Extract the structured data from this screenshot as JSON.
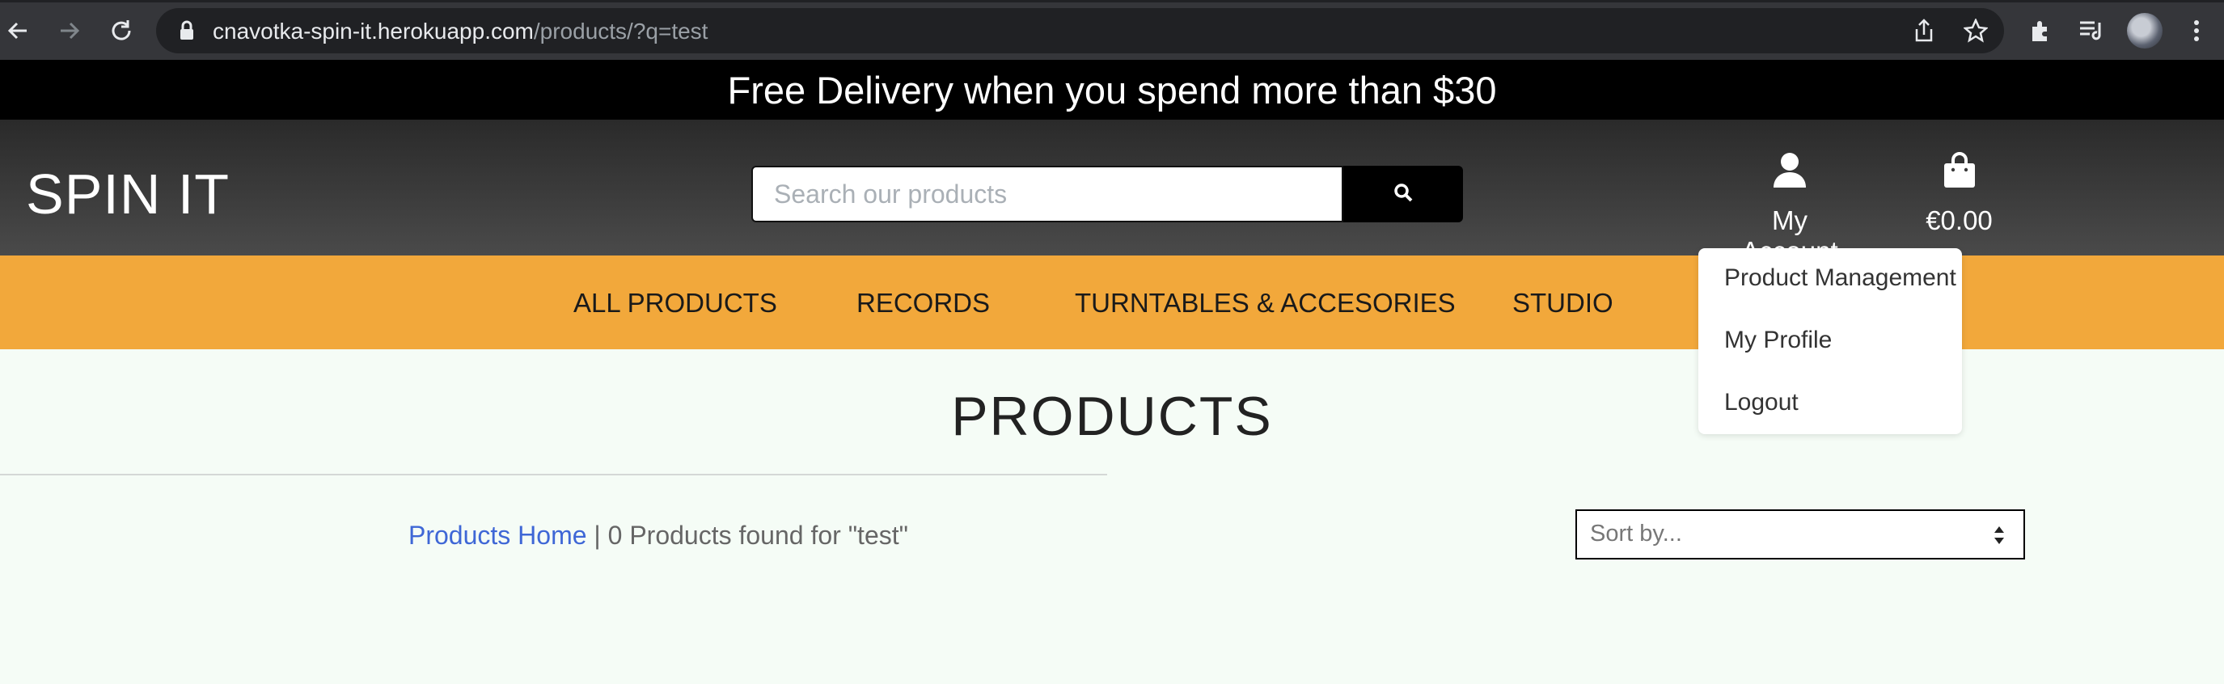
{
  "browser": {
    "url_host": "cnavotka-spin-it.herokuapp.com",
    "url_path": "/products/?q=test",
    "icons": [
      "back-icon",
      "forward-icon",
      "reload-icon",
      "lock-icon",
      "share-icon",
      "star-icon",
      "extensions-icon",
      "media-icon",
      "profile-avatar",
      "menu-icon"
    ]
  },
  "promo": {
    "text": "Free Delivery when you spend more than $30"
  },
  "header": {
    "logo": "SPIN IT",
    "search_placeholder": "Search our products",
    "account_label": "My Account",
    "cart_total": "€0.00"
  },
  "nav": {
    "items": [
      "ALL PRODUCTS",
      "RECORDS",
      "TURNTABLES & ACCESORIES",
      "STUDIO"
    ]
  },
  "account_menu": {
    "items": [
      "Product Management",
      "My Profile",
      "Logout"
    ]
  },
  "main": {
    "title": "PRODUCTS",
    "breadcrumb_link": "Products Home",
    "breadcrumb_sep": " | ",
    "results_text": "0 Products found for \"test\"",
    "sort_selected": "Sort by..."
  },
  "colors": {
    "nav_bg": "#f2a83b",
    "header_bg": "#3a3a3a",
    "promo_bg": "#000000",
    "page_bg": "#f5fcf6",
    "link": "#3f67d6"
  }
}
